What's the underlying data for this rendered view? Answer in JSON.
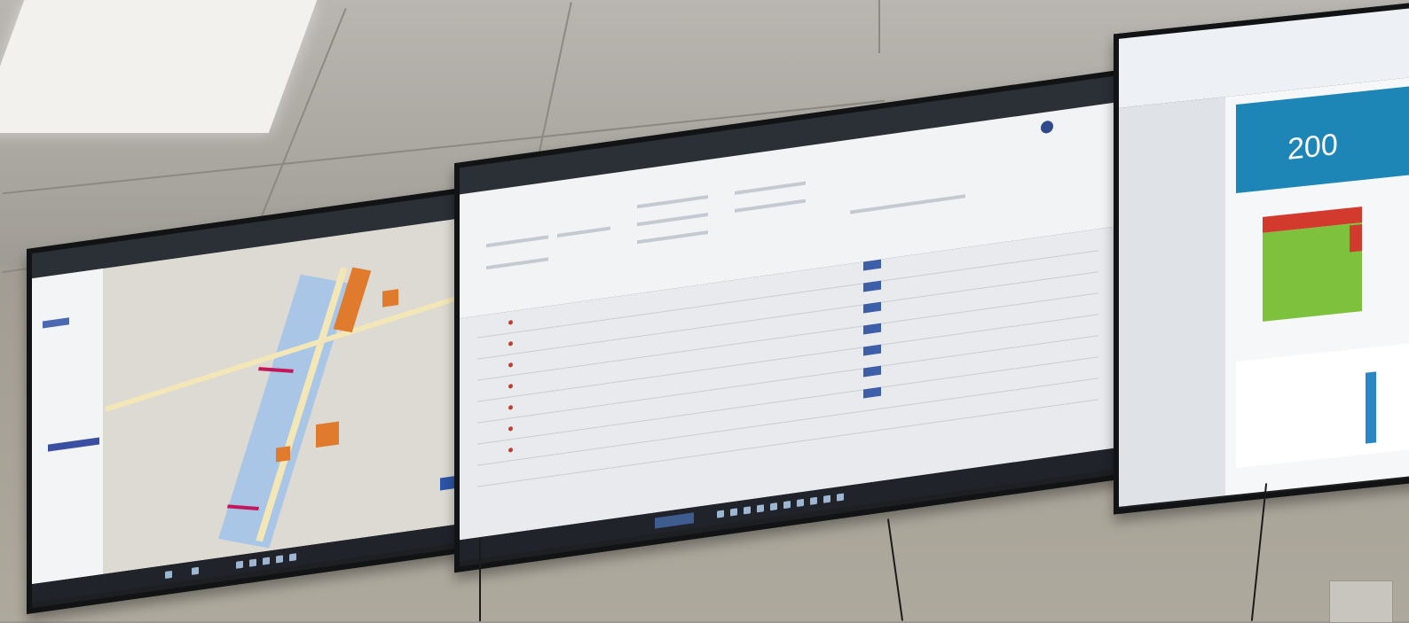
{
  "kpi_panel": {
    "value": "200"
  },
  "colors": {
    "map_water": "#a9c6e6",
    "map_building": "#e07a2c",
    "chart_ok": "#7ec13d",
    "chart_alert": "#d23a2e",
    "kpi_header": "#1d86b6"
  }
}
